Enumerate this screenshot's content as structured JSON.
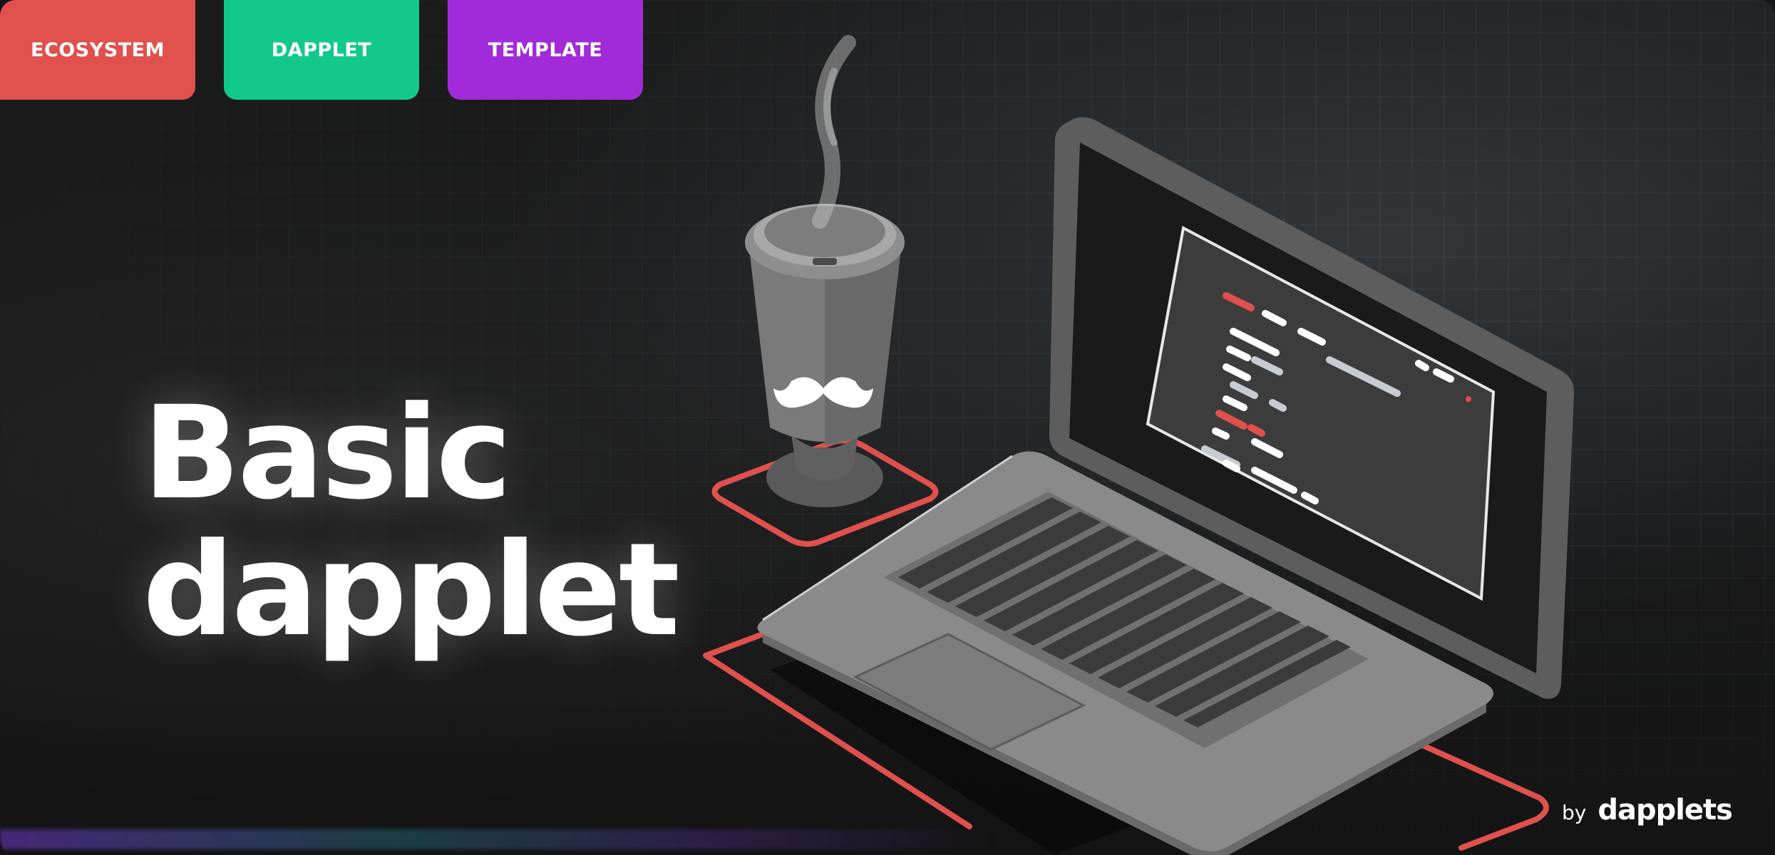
{
  "tags": {
    "ecosystem": "ECOSYSTEM",
    "dapplet": "DAPPLET",
    "template": "TEMPLATE"
  },
  "headline": {
    "line1": "Basic",
    "line2": "dapplet"
  },
  "brand": {
    "by": "by",
    "name": "dapplets"
  },
  "icons": {
    "cup": "coffee-cup-icon",
    "mustache": "mustache-icon",
    "laptop": "laptop-icon"
  },
  "colors": {
    "ecosystem": "#e0504d",
    "dapplet": "#12c98b",
    "template": "#a12bd9",
    "accent_red": "#e0504d"
  }
}
